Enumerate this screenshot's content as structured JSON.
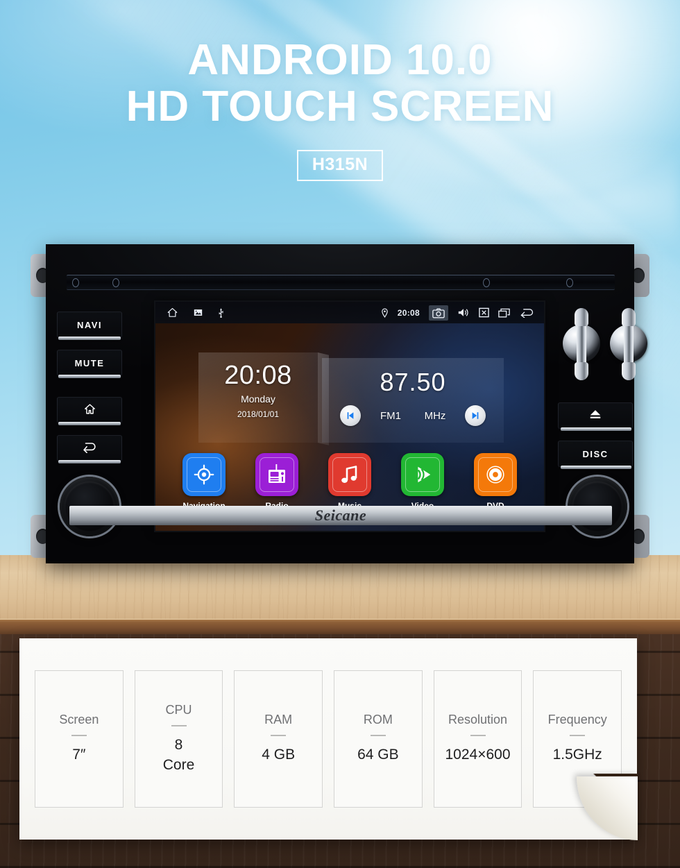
{
  "hero": {
    "line1": "ANDROID 10.0",
    "line2": "HD TOUCH SCREEN",
    "model": "H315N"
  },
  "device": {
    "brand": "Seicane",
    "left_buttons": [
      {
        "name": "navi",
        "label": "NAVI",
        "icon": ""
      },
      {
        "name": "mute",
        "label": "MUTE",
        "icon": ""
      },
      {
        "name": "home",
        "label": "",
        "icon": "home-icon"
      },
      {
        "name": "back",
        "label": "",
        "icon": "back-icon"
      }
    ],
    "right_buttons": [
      {
        "name": "eject",
        "label": "",
        "icon": "eject-icon"
      },
      {
        "name": "disc",
        "label": "DISC",
        "icon": ""
      }
    ],
    "knobs": {
      "left_label": "volume-knob",
      "right_label": "tune-knob"
    }
  },
  "screen": {
    "statusbar": {
      "left_icons": [
        "home-icon",
        "image-icon",
        "usb-icon"
      ],
      "location_icon": "location-pin-icon",
      "time": "20:08",
      "right_icons": [
        "camera-icon",
        "volume-icon",
        "close-box-icon",
        "recents-icon",
        "back-icon"
      ]
    },
    "clock_widget": {
      "time": "20:08",
      "day": "Monday",
      "date": "2018/01/01"
    },
    "radio_widget": {
      "frequency": "87.50",
      "band": "FM1",
      "unit": "MHz",
      "prev_icon": "skip-previous-icon",
      "next_icon": "skip-next-icon"
    },
    "apps": [
      {
        "label": "Navigation",
        "color": "#1f7ef0",
        "icon": "navigation-target-icon"
      },
      {
        "label": "Radio",
        "color": "#9b1fd6",
        "icon": "radio-icon"
      },
      {
        "label": "Music",
        "color": "#e03a2f",
        "icon": "music-note-icon"
      },
      {
        "label": "Video",
        "color": "#22b733",
        "icon": "video-play-icon"
      },
      {
        "label": "DVD",
        "color": "#f4790a",
        "icon": "dvd-disc-icon"
      }
    ]
  },
  "specs": [
    {
      "key": "Screen",
      "value": "7″"
    },
    {
      "key": "CPU",
      "value": "8\nCore"
    },
    {
      "key": "RAM",
      "value": "4 GB"
    },
    {
      "key": "ROM",
      "value": "64 GB"
    },
    {
      "key": "Resolution",
      "value": "1024×600"
    },
    {
      "key": "Frequency",
      "value": "1.5GHz"
    }
  ]
}
